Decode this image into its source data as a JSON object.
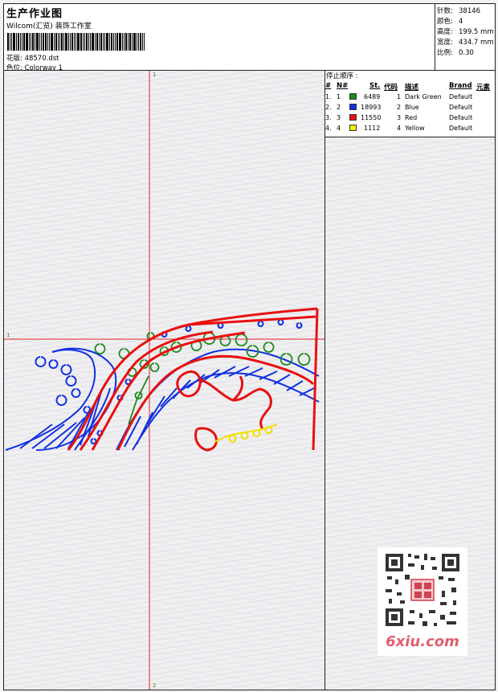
{
  "header": {
    "title": "生产作业图",
    "subtitle": "Wilcom(汇览) 装饰工作室",
    "design_label": "花版:",
    "design_value": "48570.dst",
    "colorway_label": "色位:",
    "colorway_value": "Colorway 1"
  },
  "stats": [
    {
      "label": "针数:",
      "value": "38146"
    },
    {
      "label": "颜色:",
      "value": "4"
    },
    {
      "label": "高度:",
      "value": "199.5 mm"
    },
    {
      "label": "宽度:",
      "value": "434.7 mm"
    },
    {
      "label": "比例:",
      "value": "0.30"
    }
  ],
  "stop_sequence": {
    "title": "停止顺序 :",
    "columns": [
      "#",
      "N#",
      "St.",
      "代码",
      "描述",
      "Brand",
      "元素"
    ],
    "rows": [
      {
        "index": "1.",
        "n": "1",
        "stitches": "6489",
        "code": "1",
        "description": "Dark Green",
        "brand": "Default",
        "color": "#1a8a1a"
      },
      {
        "index": "2.",
        "n": "2",
        "stitches": "18993",
        "code": "2",
        "description": "Blue",
        "brand": "Default",
        "color": "#1030e0"
      },
      {
        "index": "3.",
        "n": "3",
        "stitches": "11550",
        "code": "3",
        "description": "Red",
        "brand": "Default",
        "color": "#e81010"
      },
      {
        "index": "4.",
        "n": "4",
        "stitches": "1112",
        "code": "4",
        "description": "Yellow",
        "brand": "Default",
        "color": "#f0f000"
      }
    ]
  },
  "canvas": {
    "axis_top": "1",
    "axis_left": "1",
    "axis_bottom": "2"
  },
  "watermark": {
    "site": "6xiu.com"
  }
}
